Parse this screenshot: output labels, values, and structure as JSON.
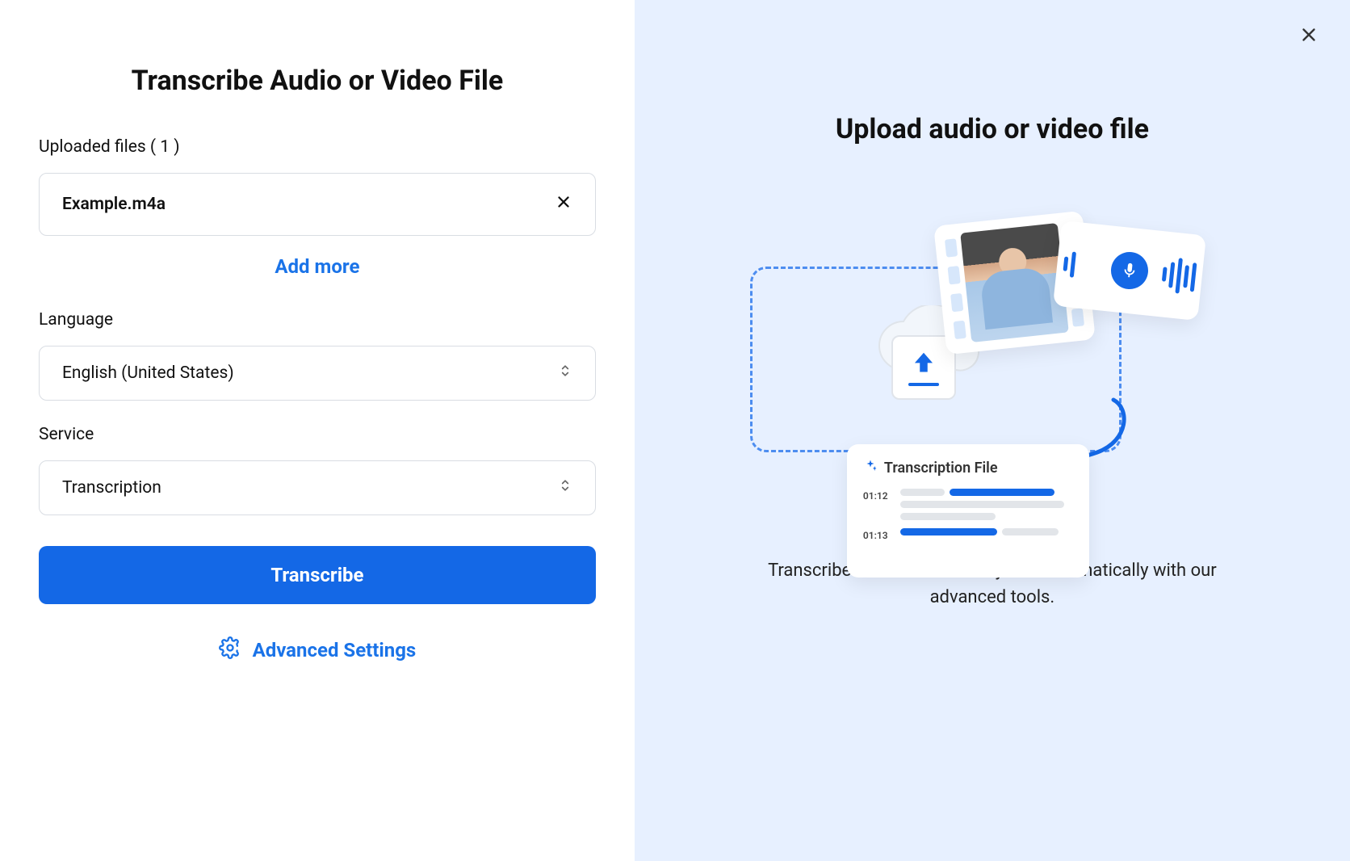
{
  "left": {
    "title": "Transcribe Audio or Video File",
    "uploaded_label": "Uploaded files ( 1 )",
    "files": [
      {
        "name": "Example.m4a"
      }
    ],
    "add_more": "Add more",
    "language_label": "Language",
    "language_value": "English (United States)",
    "service_label": "Service",
    "service_value": "Transcription",
    "transcribe_button": "Transcribe",
    "advanced_settings": "Advanced Settings"
  },
  "right": {
    "title": "Upload audio or video file",
    "transcription_card_title": "Transcription File",
    "transcription_times": [
      "01:12",
      "01:13"
    ],
    "description": "Transcribe audio to text easily and automatically with our advanced tools."
  }
}
